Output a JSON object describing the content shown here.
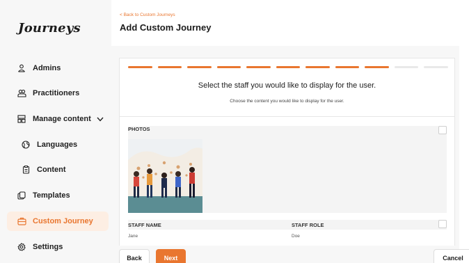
{
  "app": {
    "logo_text": "Journeys"
  },
  "sidebar": {
    "items": [
      {
        "label": "Admins",
        "icon": "user-icon"
      },
      {
        "label": "Practitioners",
        "icon": "users-icon"
      },
      {
        "label": "Manage content",
        "icon": "content-icon",
        "expanded": true
      },
      {
        "label": "Languages",
        "icon": "globe-icon"
      },
      {
        "label": "Content",
        "icon": "document-icon"
      },
      {
        "label": "Templates",
        "icon": "copy-icon"
      },
      {
        "label": "Custom Journey",
        "icon": "briefcase-icon",
        "active": true
      },
      {
        "label": "Settings",
        "icon": "gear-icon"
      }
    ]
  },
  "header": {
    "back_link": "< Back to Custom Journeys",
    "title": "Add Custom Journey"
  },
  "wizard": {
    "steps_total": 11,
    "steps_completed": 9,
    "title": "Select the staff you would like to display for the user.",
    "subtitle": "Choose the content you would like to display for the user."
  },
  "photos": {
    "label": "PHOTOS",
    "checked": false
  },
  "staff_table": {
    "columns": [
      "STAFF NAME",
      "STAFF ROLE"
    ],
    "rows": [
      {
        "name": "Jane",
        "role": "Doe"
      }
    ]
  },
  "footer": {
    "back_label": "Back",
    "next_label": "Next",
    "cancel_label": "Cancel"
  },
  "colors": {
    "accent": "#e9762f",
    "active_bg": "#fdeee3",
    "sidebar_bg": "#f7f7f7"
  }
}
